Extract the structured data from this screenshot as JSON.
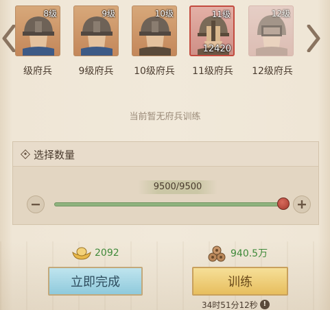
{
  "units": [
    {
      "level_badge": "8级",
      "name": "级府兵",
      "count": "",
      "state": "normal"
    },
    {
      "level_badge": "9级",
      "name": "9级府兵",
      "count": "",
      "state": "normal"
    },
    {
      "level_badge": "10级",
      "name": "10级府兵",
      "count": "",
      "state": "normal"
    },
    {
      "level_badge": "11级",
      "name": "11级府兵",
      "count": "12420",
      "state": "selected"
    },
    {
      "level_badge": "12级",
      "name": "12级府兵",
      "count": "",
      "state": "locked"
    }
  ],
  "status_text": "当前暂无府兵训练",
  "quantity_panel": {
    "title": "选择数量",
    "value_text": "9500/9500",
    "current": 9500,
    "max": 9500
  },
  "costs": {
    "gold": "2092",
    "wood": "940.5万"
  },
  "buttons": {
    "finish_now": "立即完成",
    "train": "训练"
  },
  "train_time": "34时51分12秒",
  "colors": {
    "slider_fill": "#8fb37e",
    "slider_thumb": "#b0473a",
    "cost_green": "#3f8a3a",
    "finish_button": "#9fd2e2",
    "train_button": "#f0cf78",
    "selected_border": "#c24a3e"
  }
}
